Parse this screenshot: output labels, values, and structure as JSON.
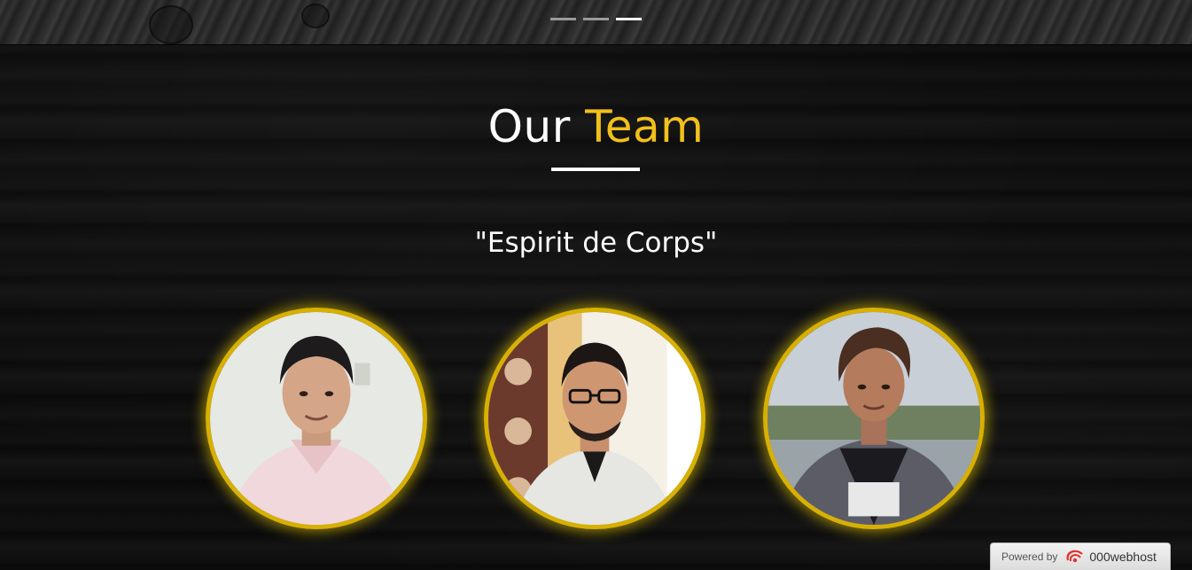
{
  "slider": {
    "indicators": [
      {
        "label": "slide-1",
        "active": false
      },
      {
        "label": "slide-2",
        "active": false
      },
      {
        "label": "slide-3",
        "active": true
      }
    ]
  },
  "section": {
    "title_main": "Our",
    "title_accent": "Team",
    "motto": "\"Espirit de Corps\""
  },
  "team": {
    "members": [
      {
        "photo": "member-1-photo"
      },
      {
        "photo": "member-2-photo"
      },
      {
        "photo": "member-3-photo"
      }
    ]
  },
  "footer_badge": {
    "powered_by": "Powered by",
    "brand": "000webhost"
  },
  "colors": {
    "accent": "#f2c01a",
    "ring": "#d8b000",
    "background": "#0b0b0b",
    "text": "#ffffff"
  }
}
